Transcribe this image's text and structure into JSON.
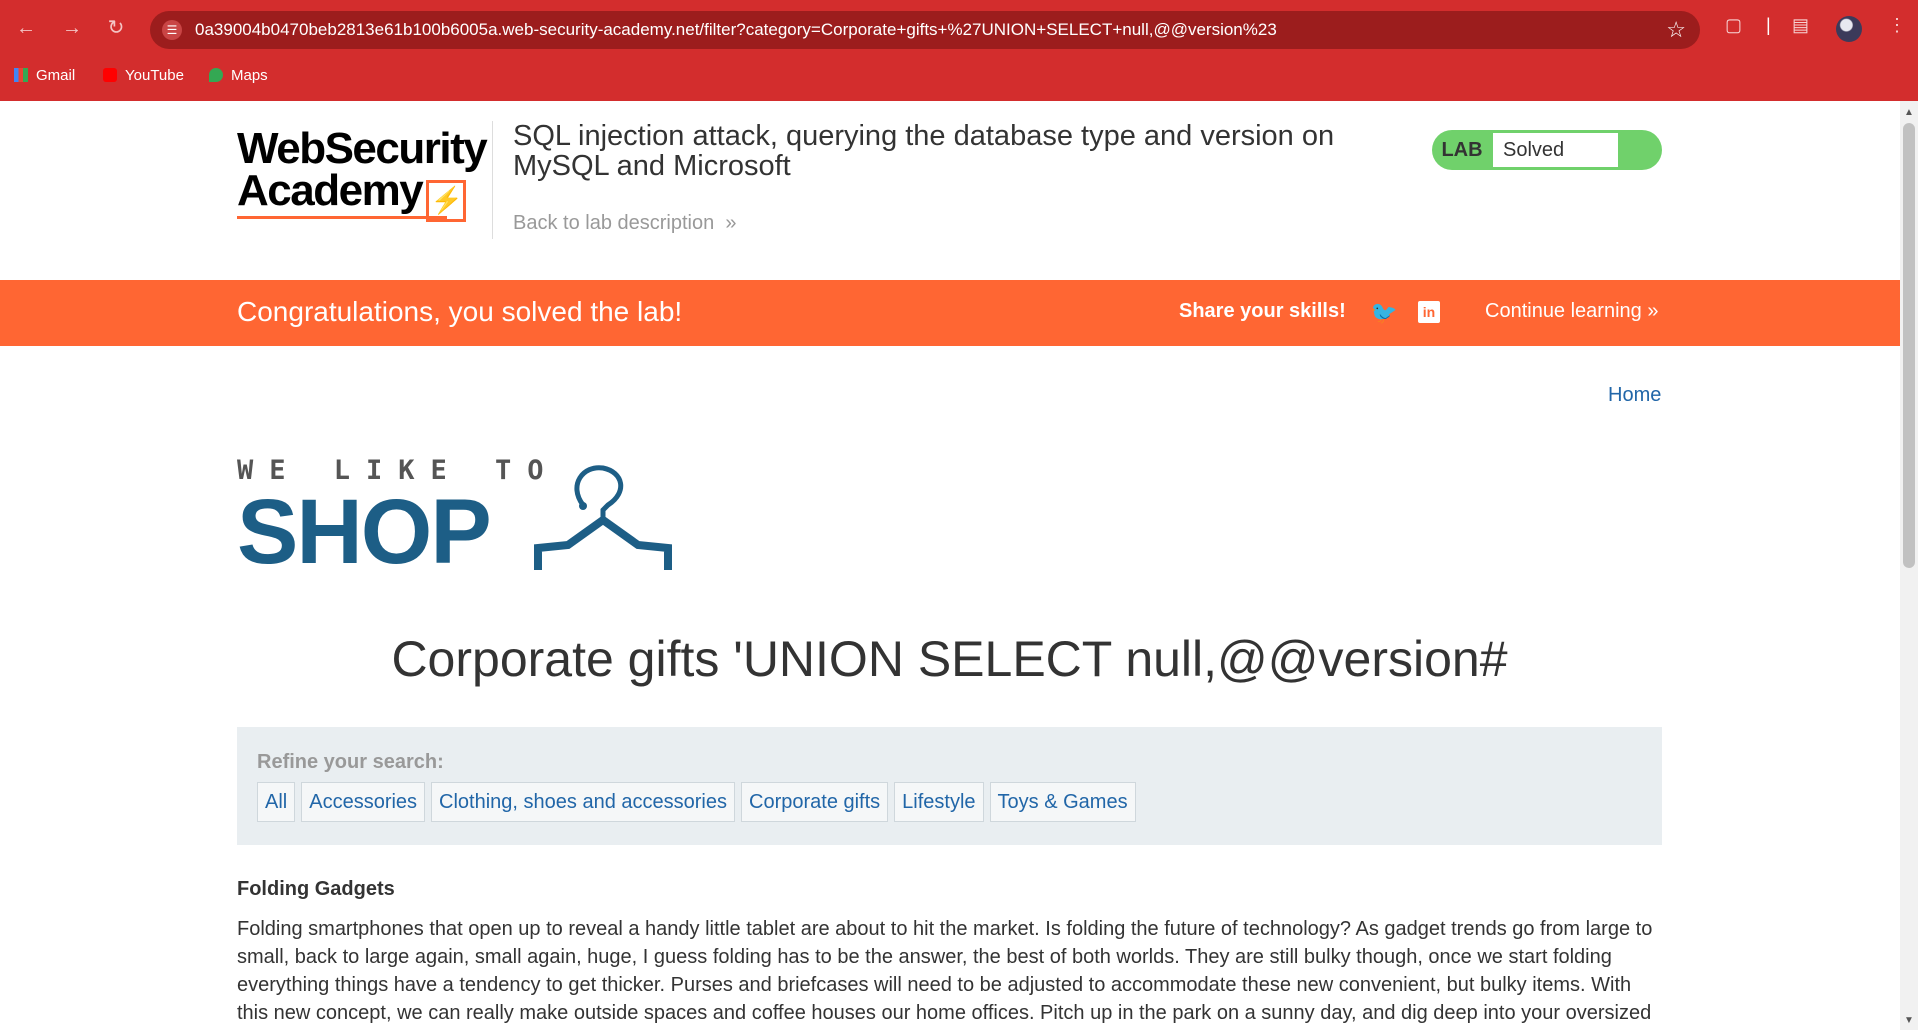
{
  "browser": {
    "url": "0a39004b0470beb2813e61b100b6005a.web-security-academy.net/filter?category=Corporate+gifts+%27UNION+SELECT+null,@@version%23",
    "bookmarks": [
      {
        "label": "Gmail",
        "icon": "gmail-icon"
      },
      {
        "label": "YouTube",
        "icon": "youtube-icon"
      },
      {
        "label": "Maps",
        "icon": "maps-icon"
      }
    ]
  },
  "academy_header": {
    "logo_line1": "WebSecurity",
    "logo_line2": "Academy",
    "lab_title": "SQL injection attack, querying the database type and version on MySQL and Microsoft",
    "back_link": "Back to lab description",
    "lab_badge": "LAB",
    "lab_status": "Solved"
  },
  "banner": {
    "message": "Congratulations, you solved the lab!",
    "share": "Share your skills!",
    "continue": "Continue learning"
  },
  "shop": {
    "home_link": "Home",
    "logo_tagline": "WE LIKE TO",
    "logo_word": "SHOP",
    "page_heading": "Corporate gifts 'UNION SELECT null,@@version#",
    "refine_label": "Refine your search:",
    "filters": [
      "All",
      "Accessories",
      "Clothing, shoes and accessories",
      "Corporate gifts",
      "Lifestyle",
      "Toys & Games"
    ]
  },
  "post": {
    "title": "Folding Gadgets",
    "body": "Folding smartphones that open up to reveal a handy little tablet are about to hit the market. Is folding the future of technology? As gadget trends go from large to small, back to large again, small again, huge, I guess folding has to be the answer, the best of both worlds. They are still bulky though, once we start folding everything things have a tendency to get thicker. Purses and briefcases will need to be adjusted to accommodate these new convenient, but bulky items. With this new concept, we can really make outside spaces and coffee houses our home offices. Pitch up in the park on a sunny day, and dig deep into your oversized"
  },
  "colors": {
    "chrome": "#d32d2d",
    "banner": "#ff6633",
    "lab_solved": "#70d16b",
    "link": "#2166a8",
    "shop_blue": "#1d5e86"
  }
}
